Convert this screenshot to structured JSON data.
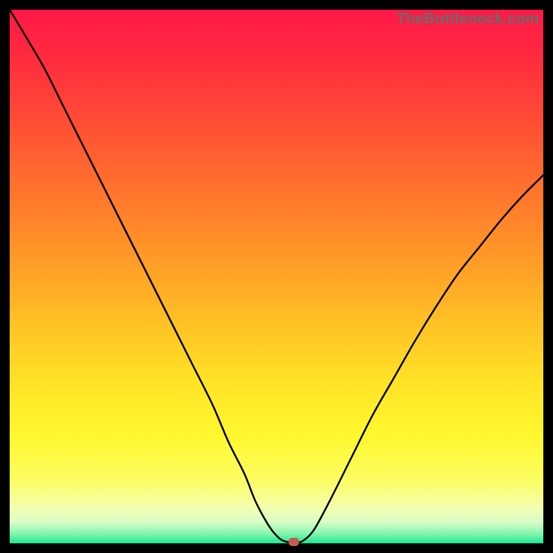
{
  "watermark": "TheBottleneck.com",
  "chart_data": {
    "type": "line",
    "title": "",
    "xlabel": "",
    "ylabel": "",
    "xlim": [
      0,
      100
    ],
    "ylim": [
      0,
      100
    ],
    "x": [
      0,
      3,
      6.5,
      10,
      14,
      18,
      22,
      26,
      30,
      34,
      38,
      41,
      44,
      46,
      48,
      49.5,
      51,
      52.5,
      54,
      55,
      57,
      60,
      64,
      68,
      72,
      76,
      80,
      84,
      88,
      92,
      96,
      100
    ],
    "y": [
      100,
      95,
      89,
      82,
      74,
      66,
      58,
      50,
      42,
      34,
      26,
      19,
      13,
      8,
      4.2,
      2,
      0.6,
      0.2,
      0.2,
      0.5,
      2.5,
      8,
      16,
      24,
      31,
      38,
      44.5,
      50.5,
      55.5,
      60.5,
      65,
      69
    ],
    "marker": {
      "x": 53.3,
      "y": 0.2
    },
    "background_gradient": {
      "top": "#ff1848",
      "upper_mid": "#ff9528",
      "mid": "#ffe326",
      "lower_mid": "#f4feab",
      "bottom": "#1ee88f"
    },
    "line_color": "#000000",
    "marker_color": "#c55a50"
  }
}
